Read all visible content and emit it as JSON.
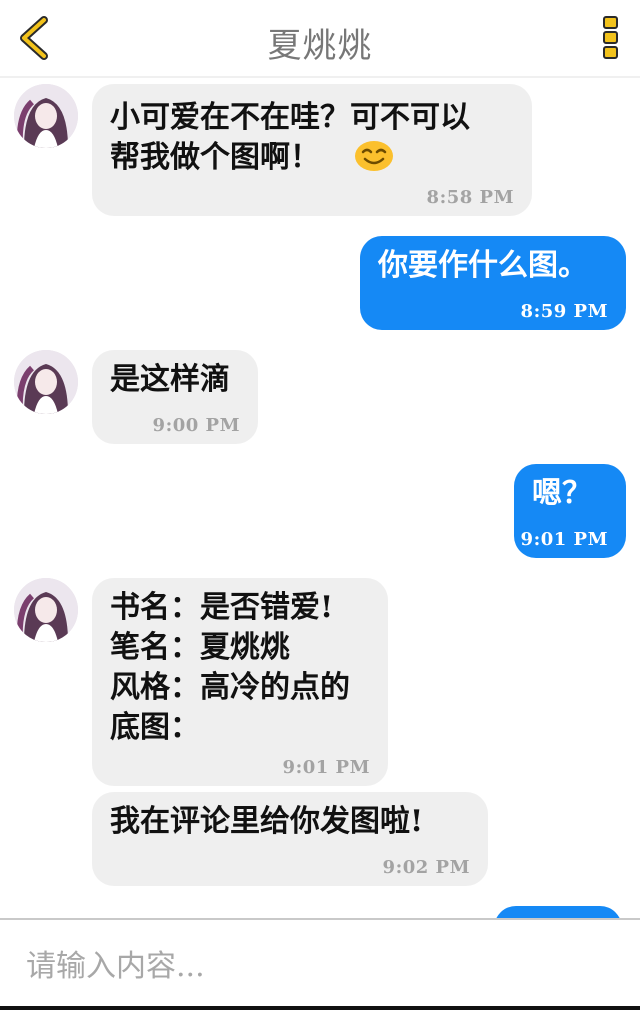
{
  "header": {
    "title": "夏烑烑",
    "back_icon": "chevron-left-icon",
    "menu_icon": "vertical-dots-icon",
    "accent_color": "#f2c21b"
  },
  "messages": [
    {
      "side": "in",
      "text": "小可爱在不在哇？可不可以\n帮我做个图啊！",
      "emoji": "smiling-face-emoji",
      "time": "8:58  PM"
    },
    {
      "side": "out",
      "text": "你要作什么图。",
      "time": "8:59  PM"
    },
    {
      "side": "in",
      "text": "是这样滴",
      "time": "9:00  PM"
    },
    {
      "side": "out",
      "text": "嗯？",
      "time": "9:01  PM"
    },
    {
      "side": "in",
      "text": "书名：是否错爱!\n笔名：夏烑烑\n风格：高冷的点的\n底图：",
      "time": "9:01  PM"
    },
    {
      "side": "in",
      "text": "我在评论里给你发图啦!",
      "time": "9:02  PM"
    }
  ],
  "colors": {
    "incoming_bubble": "#efefef",
    "outgoing_bubble": "#1589f5",
    "time_incoming": "#a3a3a3"
  },
  "input": {
    "placeholder": "请输入内容..."
  }
}
